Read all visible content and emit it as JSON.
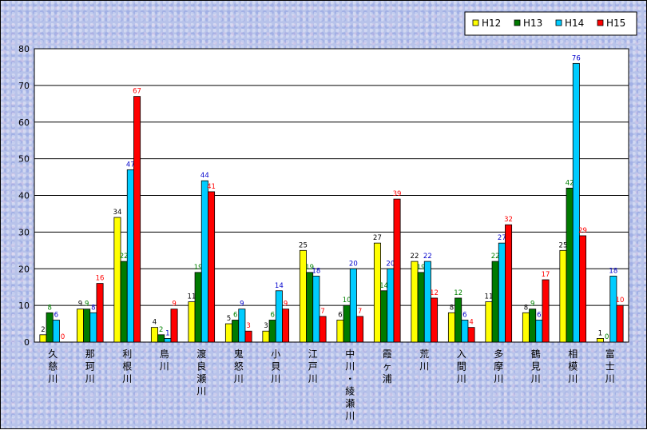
{
  "chart_data": {
    "type": "bar",
    "categories": [
      "久慈川",
      "那珂川",
      "利根川",
      "鳥川",
      "渡良瀬川",
      "鬼怒川",
      "小貝川",
      "江戸川",
      "中川・綾瀬川",
      "霞ヶ浦",
      "荒川",
      "入間川",
      "多摩川",
      "鶴見川",
      "相模川",
      "富士川"
    ],
    "series": [
      {
        "name": "H12",
        "color": "#ffff00",
        "label_color": "#000000",
        "values": [
          2,
          9,
          34,
          4,
          11,
          5,
          3,
          25,
          6,
          27,
          22,
          8,
          11,
          8,
          25,
          1
        ]
      },
      {
        "name": "H13",
        "color": "#007a00",
        "label_color": "#008000",
        "values": [
          8,
          9,
          22,
          2,
          19,
          6,
          6,
          19,
          10,
          14,
          19,
          12,
          22,
          9,
          42,
          0
        ]
      },
      {
        "name": "H14",
        "color": "#00ccff",
        "label_color": "#0000cc",
        "values": [
          6,
          8,
          47,
          1,
          44,
          9,
          14,
          18,
          20,
          20,
          22,
          6,
          27,
          6,
          76,
          18
        ]
      },
      {
        "name": "H15",
        "color": "#ff0000",
        "label_color": "#ff0000",
        "values": [
          0,
          16,
          67,
          9,
          41,
          3,
          9,
          7,
          7,
          39,
          12,
          4,
          32,
          17,
          29,
          10
        ]
      }
    ],
    "ylim": [
      0,
      80
    ],
    "yticks": [
      0,
      10,
      20,
      30,
      40,
      50,
      60,
      70,
      80
    ],
    "grid": true,
    "legend": "top-right"
  }
}
